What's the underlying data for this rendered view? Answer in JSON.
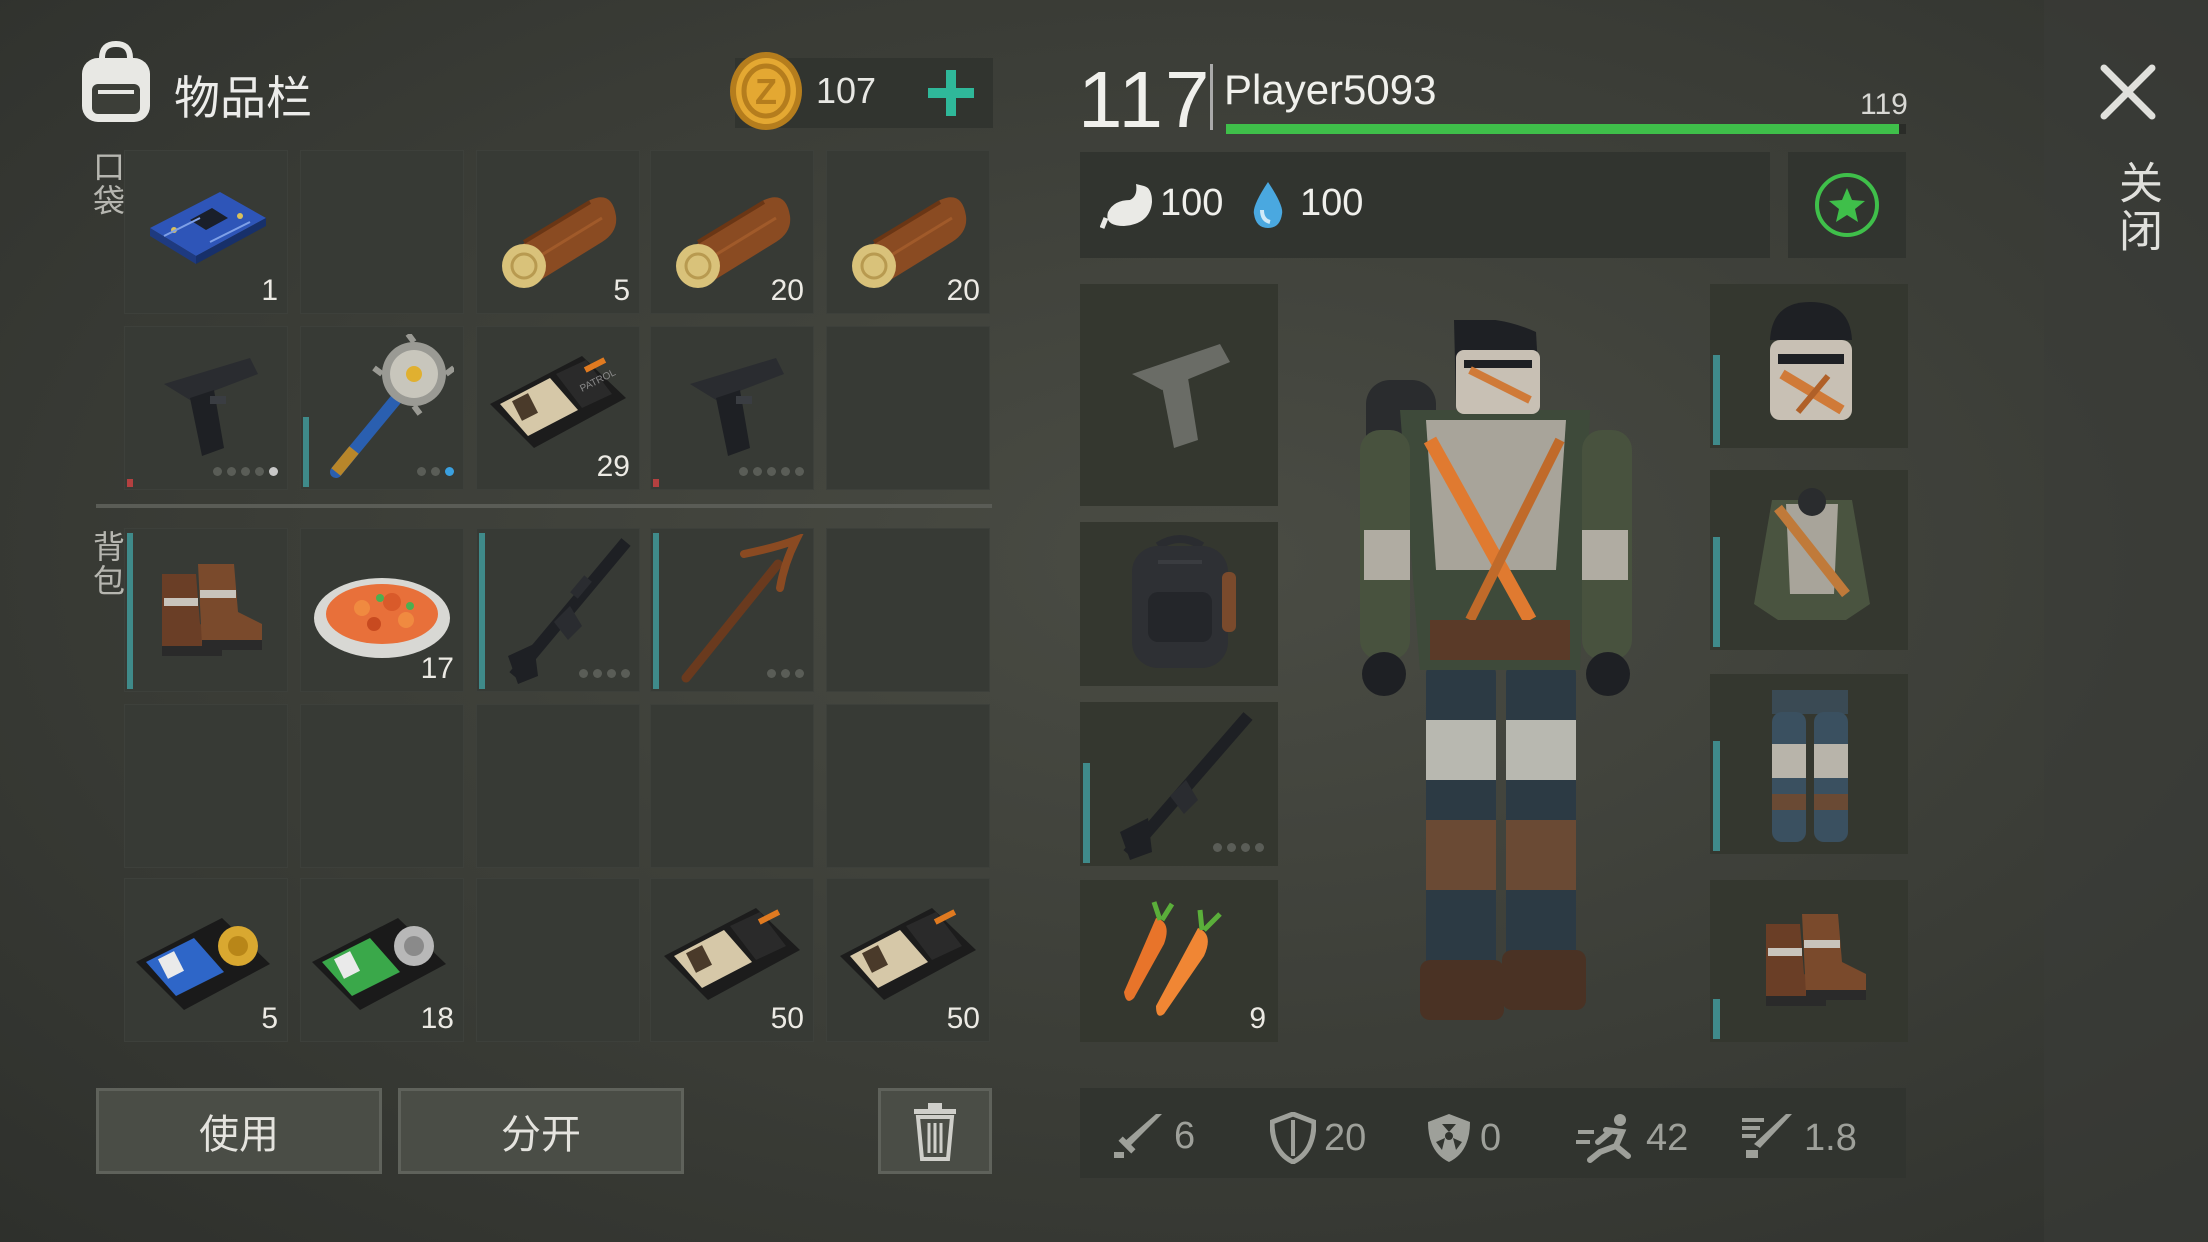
{
  "inventory": {
    "title": "物品栏",
    "coins": "107",
    "pocket_label": "口袋",
    "backpack_label": "背包",
    "pocket_row1": [
      {
        "icon": "circuit-board-icon",
        "count": "1"
      },
      {
        "icon": "",
        "count": ""
      },
      {
        "icon": "log-icon",
        "count": "5"
      },
      {
        "icon": "log-icon",
        "count": "20"
      },
      {
        "icon": "log-icon",
        "count": "20"
      }
    ],
    "pocket_row2": [
      {
        "icon": "pistol-icon",
        "count": ""
      },
      {
        "icon": "saw-mace-icon",
        "count": ""
      },
      {
        "icon": "patrol-id-icon",
        "count": "29"
      },
      {
        "icon": "pistol-icon",
        "count": ""
      },
      {
        "icon": "",
        "count": ""
      }
    ],
    "bag_row1": [
      {
        "icon": "boots-icon",
        "count": ""
      },
      {
        "icon": "food-plate-icon",
        "count": "17"
      },
      {
        "icon": "rifle-icon",
        "count": ""
      },
      {
        "icon": "pickaxe-icon",
        "count": ""
      },
      {
        "icon": "",
        "count": ""
      }
    ],
    "bag_row3": [
      {
        "icon": "police-badge-blue-icon",
        "count": "5"
      },
      {
        "icon": "police-badge-green-icon",
        "count": "18"
      },
      {
        "icon": "",
        "count": ""
      },
      {
        "icon": "patrol-id-icon",
        "count": "50"
      },
      {
        "icon": "patrol-id-icon",
        "count": "50"
      }
    ],
    "use_label": "使用",
    "split_label": "分开"
  },
  "player": {
    "level": "117",
    "name": "Player5093",
    "next_level": "119",
    "xp_progress": 0.99,
    "hunger": "100",
    "thirst": "100",
    "close_label": "关闭"
  },
  "equipment": {
    "left_slots": [
      "pistol-silhouette-icon",
      "backpack-icon",
      "rifle-icon",
      "carrots-icon"
    ],
    "carrot_count": "9",
    "right_slots": [
      "helmet-icon",
      "jacket-icon",
      "pants-icon",
      "boots-icon"
    ]
  },
  "stats": {
    "attack": "6",
    "defense": "20",
    "radiation": "0",
    "speed": "42",
    "weight": "1.8"
  },
  "colors": {
    "accent_green": "#3fbf4a",
    "teal_plus": "#2fb89a",
    "slot_bg": "#373a35"
  }
}
